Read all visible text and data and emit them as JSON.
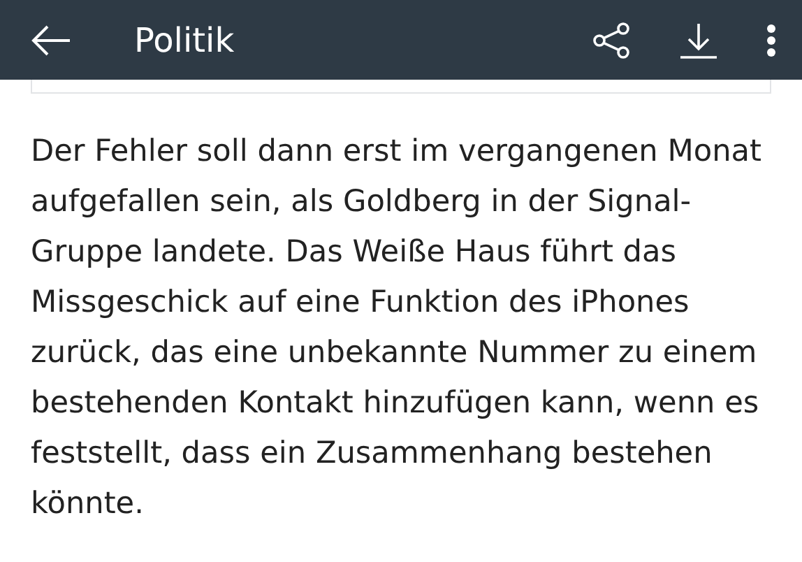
{
  "app_bar": {
    "title": "Politik"
  },
  "article": {
    "paragraph": "Der Fehler soll dann erst im vergangenen Monat aufgefallen sein, als Goldberg in der Signal-Gruppe landete. Das Weiße Haus führt das Missgeschick auf eine Funktion des iPhones zurück, das eine unbekannte Nummer zu einem bestehenden Kontakt hinzufügen kann, wenn es feststellt, dass ein Zusammenhang bestehen könnte."
  }
}
